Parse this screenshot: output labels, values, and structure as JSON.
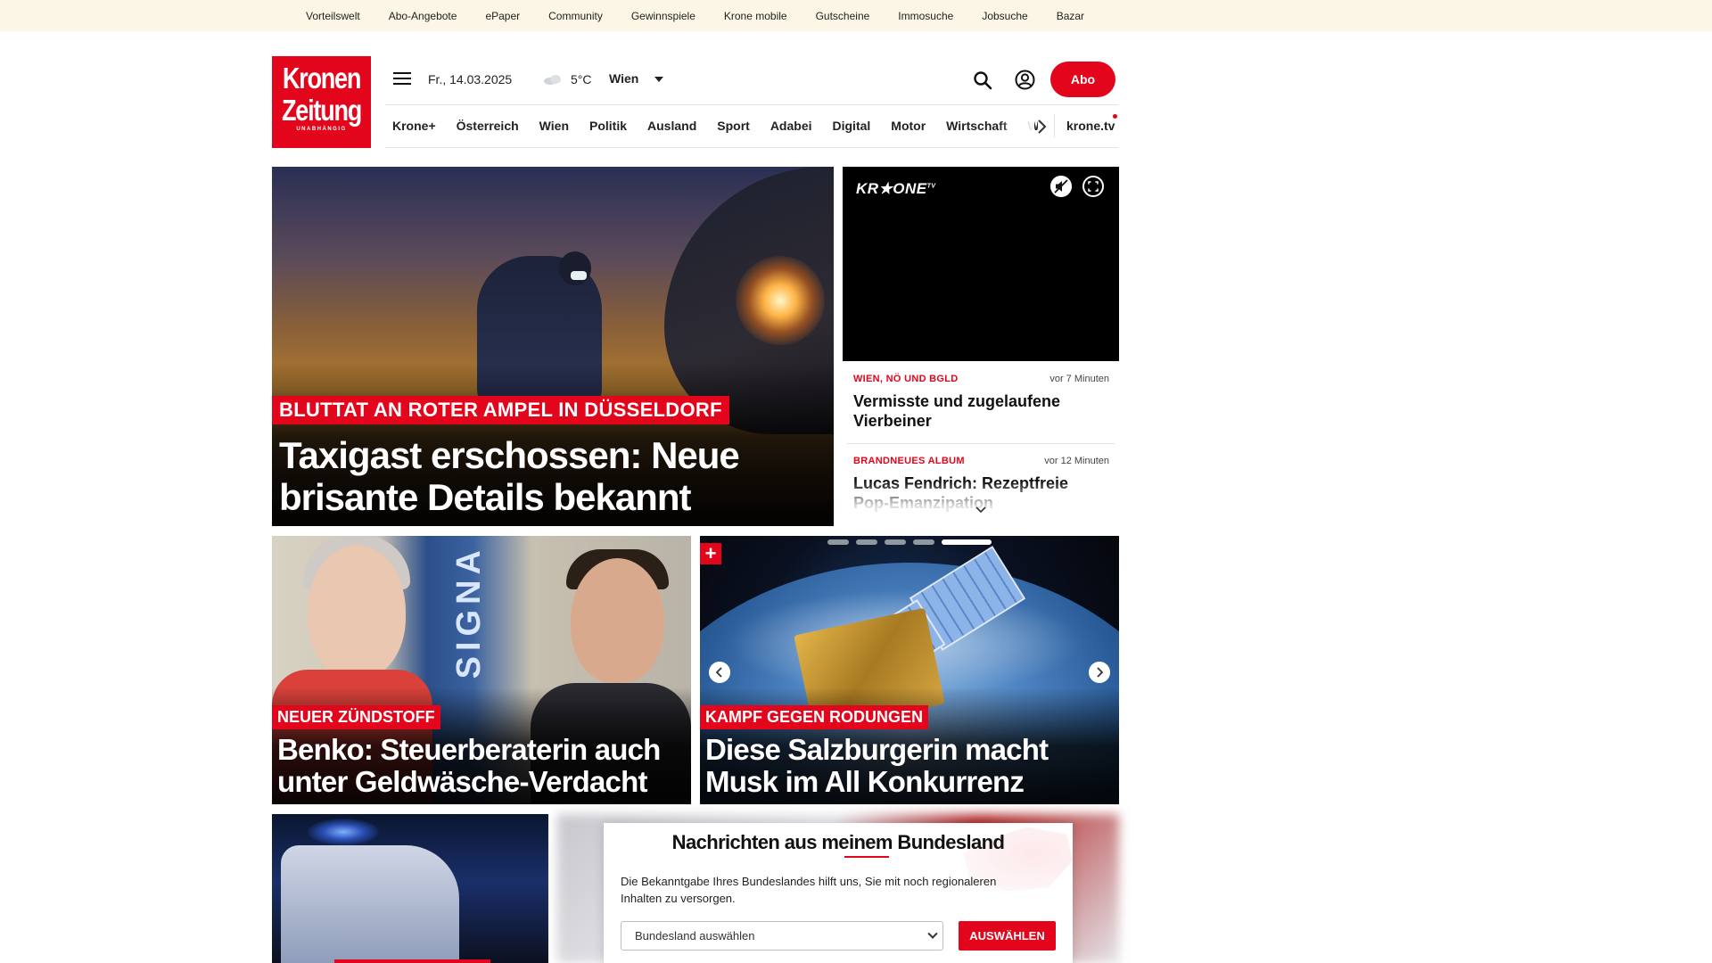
{
  "top_links": [
    "Vorteilswelt",
    "Abo-Angebote",
    "ePaper",
    "Community",
    "Gewinnspiele",
    "Krone mobile",
    "Gutscheine",
    "Immosuche",
    "Jobsuche",
    "Bazar"
  ],
  "logo": {
    "line1": "Kronen",
    "line2": "Zeitung",
    "tagline": "UNABHÄNGIG"
  },
  "header": {
    "date": "Fr., 14.03.2025",
    "temperature": "5°C",
    "city": "Wien",
    "abo_label": "Abo",
    "weather_icon": "cloud-icon"
  },
  "nav": {
    "items": [
      "Krone+",
      "Österreich",
      "Wien",
      "Politik",
      "Ausland",
      "Sport",
      "Adabei",
      "Digital",
      "Motor",
      "Wirtschaft",
      "Wissenschaft"
    ],
    "tv_label": "krone.tv"
  },
  "hero": {
    "kicker": "BLUTTAT AN ROTER AMPEL IN DÜSSELDORF",
    "title": "Taxigast erschossen: Neue brisante Details bekannt"
  },
  "video": {
    "brand": "KR★ONE",
    "brand_suffix": "TV"
  },
  "sidebar": [
    {
      "category": "WIEN, NÖ UND BGLD",
      "time": "vor 7 Minuten",
      "headline": "Vermisste und zugelaufene Vierbeiner"
    },
    {
      "category": "BRANDNEUES ALBUM",
      "time": "vor 12 Minuten",
      "headline": "Lucas Fendrich: Rezeptfreie Pop-Emanzipation"
    }
  ],
  "teasers": [
    {
      "kicker": "NEUER ZÜNDSTOFF",
      "title": "Benko: Steuerberaterin auch unter Geldwäsche-Verdacht",
      "image_text": "SIGNA"
    },
    {
      "kicker": "KAMPF GEGEN RODUNGEN",
      "title": "Diese Salzburgerin macht Musk im All Konkurrenz",
      "badge": "+"
    }
  ],
  "region_prompt": {
    "title": "Nachrichten aus meinem Bundesland",
    "text": "Die Bekanntgabe Ihres Bundeslandes hilft uns, Sie mit noch regionaleren Inhalten zu versorgen.",
    "select_placeholder": "Bundesland auswählen",
    "button": "AUSWÄHLEN"
  },
  "colors": {
    "brand_red": "#e3051b",
    "utility_bar": "#fbf6e6",
    "text": "#111111"
  }
}
